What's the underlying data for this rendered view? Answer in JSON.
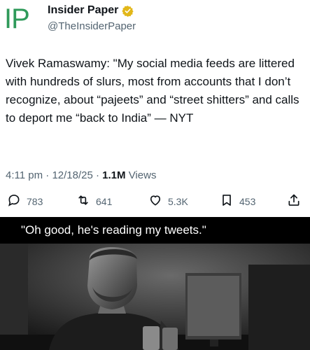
{
  "account": {
    "logo_text": "IP",
    "display_name": "Insider Paper",
    "handle": "@TheInsiderPaper"
  },
  "tweet": {
    "text": "Vivek Ramaswamy: \"My social media feeds are littered with hundreds of slurs, most from accounts that I don’t recognize, about “pajeets” and “street shitters” and calls to deport me “back to India” — NYT",
    "time": "4:11 pm",
    "date": "12/18/25",
    "views_count": "1.1M",
    "views_label": "Views"
  },
  "actions": {
    "replies": "783",
    "reposts": "641",
    "likes": "5.3K",
    "bookmarks": "453"
  },
  "meme": {
    "caption": "\"Oh good, he's reading my tweets.\""
  },
  "colors": {
    "logo_green": "#2f9a5a",
    "verified_gold": "#e2b719",
    "secondary_text": "#536471"
  }
}
